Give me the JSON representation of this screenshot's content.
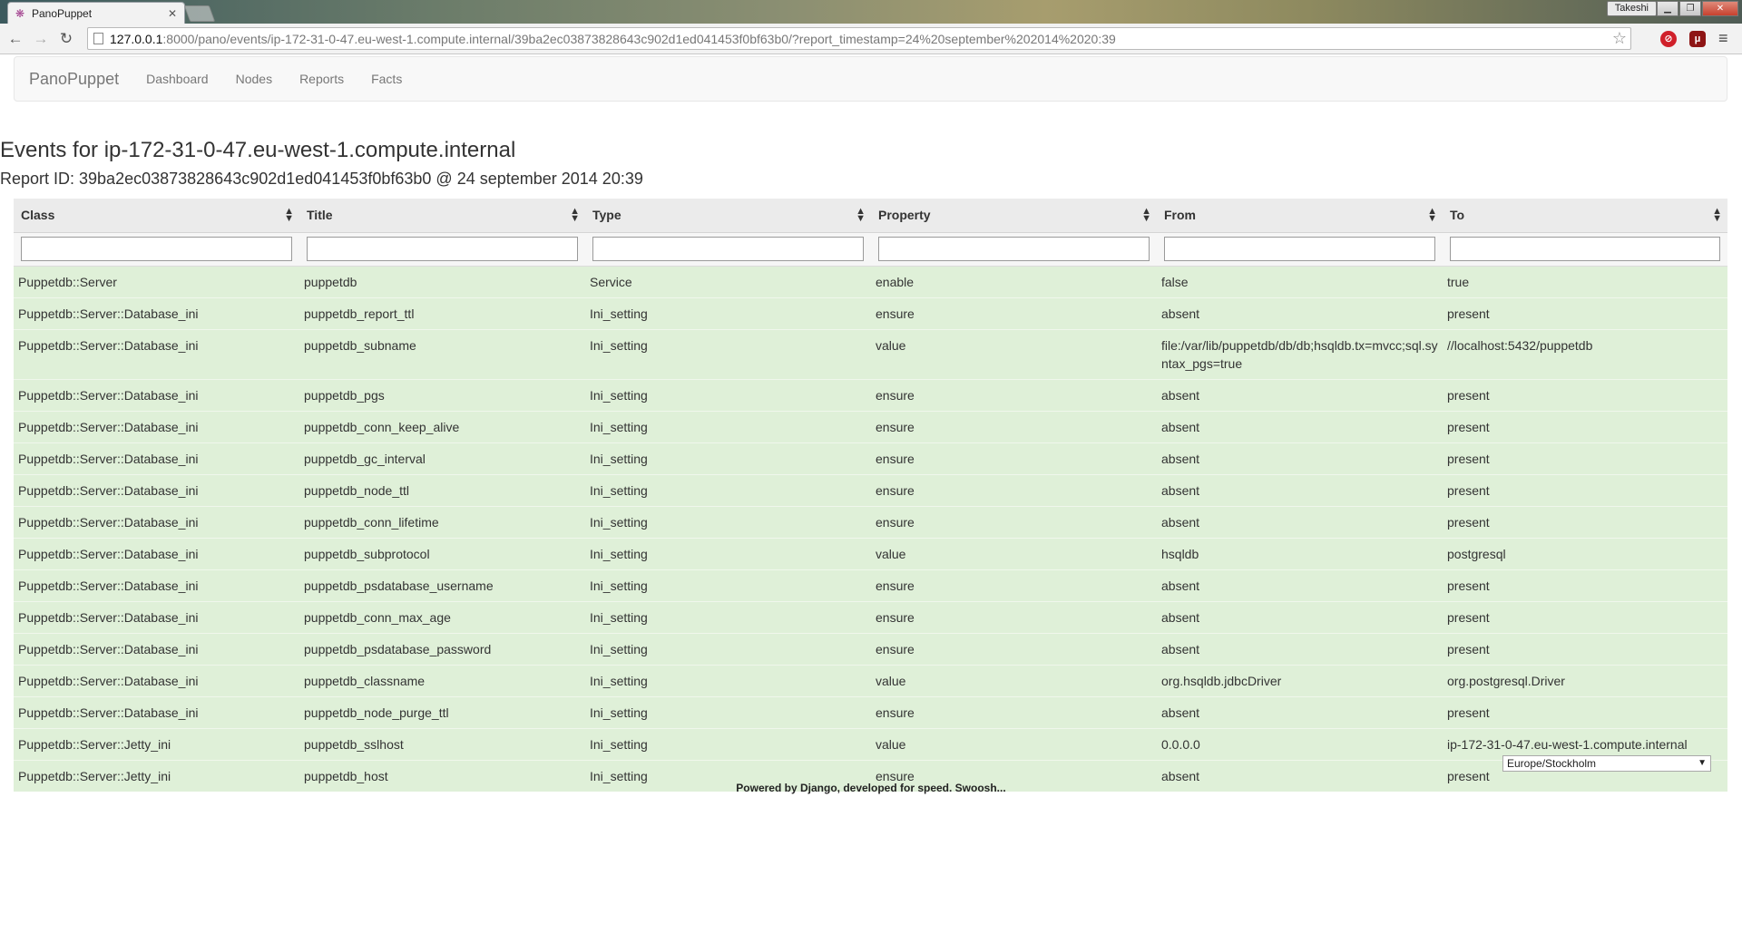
{
  "browser": {
    "tab_title": "PanoPuppet",
    "tab_close": "✕",
    "user_badge": "Takeshi",
    "url_host": "127.0.0.1",
    "url_rest": ":8000/pano/events/ip-172-31-0-47.eu-west-1.compute.internal/39ba2ec03873828643c902d1ed041453f0bf63b0/?report_timestamp=24%20september%202014%2020:39"
  },
  "navbar": {
    "brand": "PanoPuppet",
    "links": [
      "Dashboard",
      "Nodes",
      "Reports",
      "Facts"
    ]
  },
  "page": {
    "heading": "Events for ip-172-31-0-47.eu-west-1.compute.internal",
    "report_id": "Report ID: 39ba2ec03873828643c902d1ed041453f0bf63b0 @ 24 september 2014 20:39"
  },
  "table": {
    "columns": [
      "Class",
      "Title",
      "Type",
      "Property",
      "From",
      "To"
    ],
    "rows": [
      [
        "Puppetdb::Server",
        "puppetdb",
        "Service",
        "enable",
        "false",
        "true"
      ],
      [
        "Puppetdb::Server::Database_ini",
        "puppetdb_report_ttl",
        "Ini_setting",
        "ensure",
        "absent",
        "present"
      ],
      [
        "Puppetdb::Server::Database_ini",
        "puppetdb_subname",
        "Ini_setting",
        "value",
        "file:/var/lib/puppetdb/db/db;hsqldb.tx=mvcc;sql.syntax_pgs=true",
        "//localhost:5432/puppetdb"
      ],
      [
        "Puppetdb::Server::Database_ini",
        "puppetdb_pgs",
        "Ini_setting",
        "ensure",
        "absent",
        "present"
      ],
      [
        "Puppetdb::Server::Database_ini",
        "puppetdb_conn_keep_alive",
        "Ini_setting",
        "ensure",
        "absent",
        "present"
      ],
      [
        "Puppetdb::Server::Database_ini",
        "puppetdb_gc_interval",
        "Ini_setting",
        "ensure",
        "absent",
        "present"
      ],
      [
        "Puppetdb::Server::Database_ini",
        "puppetdb_node_ttl",
        "Ini_setting",
        "ensure",
        "absent",
        "present"
      ],
      [
        "Puppetdb::Server::Database_ini",
        "puppetdb_conn_lifetime",
        "Ini_setting",
        "ensure",
        "absent",
        "present"
      ],
      [
        "Puppetdb::Server::Database_ini",
        "puppetdb_subprotocol",
        "Ini_setting",
        "value",
        "hsqldb",
        "postgresql"
      ],
      [
        "Puppetdb::Server::Database_ini",
        "puppetdb_psdatabase_username",
        "Ini_setting",
        "ensure",
        "absent",
        "present"
      ],
      [
        "Puppetdb::Server::Database_ini",
        "puppetdb_conn_max_age",
        "Ini_setting",
        "ensure",
        "absent",
        "present"
      ],
      [
        "Puppetdb::Server::Database_ini",
        "puppetdb_psdatabase_password",
        "Ini_setting",
        "ensure",
        "absent",
        "present"
      ],
      [
        "Puppetdb::Server::Database_ini",
        "puppetdb_classname",
        "Ini_setting",
        "value",
        "org.hsqldb.jdbcDriver",
        "org.postgresql.Driver"
      ],
      [
        "Puppetdb::Server::Database_ini",
        "puppetdb_node_purge_ttl",
        "Ini_setting",
        "ensure",
        "absent",
        "present"
      ],
      [
        "Puppetdb::Server::Jetty_ini",
        "puppetdb_sslhost",
        "Ini_setting",
        "value",
        "0.0.0.0",
        "ip-172-31-0-47.eu-west-1.compute.internal"
      ],
      [
        "Puppetdb::Server::Jetty_ini",
        "puppetdb_host",
        "Ini_setting",
        "ensure",
        "absent",
        "present"
      ]
    ]
  },
  "timezone": {
    "selected": "Europe/Stockholm"
  },
  "footer": {
    "text": "Powered by Django, developed for speed. Swoosh..."
  },
  "colors": {
    "row_success": "#dff0d8",
    "header_bg": "#ebebeb",
    "navbar_bg": "#f8f8f8"
  }
}
